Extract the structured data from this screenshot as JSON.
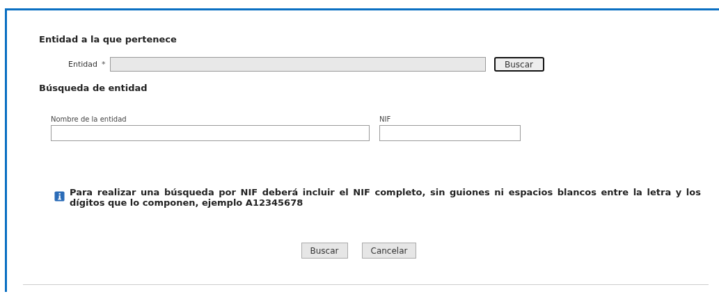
{
  "entity_section": {
    "title": "Entidad a la que pertenece",
    "field": {
      "label": "Entidad",
      "required_mark": "*",
      "disabled": true
    },
    "button": {
      "label": "Buscar",
      "focused": true
    }
  },
  "search_section": {
    "title": "Búsqueda de entidad",
    "fields": [
      {
        "label": "Nombre de la entidad"
      },
      {
        "label": "NIF"
      }
    ],
    "info": "Para realizar una búsqueda por NIF deberá incluir el NIF completo, sin guiones ni espacios blancos entre la letra y los dígitos que lo componen, ejemplo A12345678"
  },
  "buttons": [
    {
      "label": "Buscar"
    },
    {
      "label": "Cancelar"
    }
  ]
}
